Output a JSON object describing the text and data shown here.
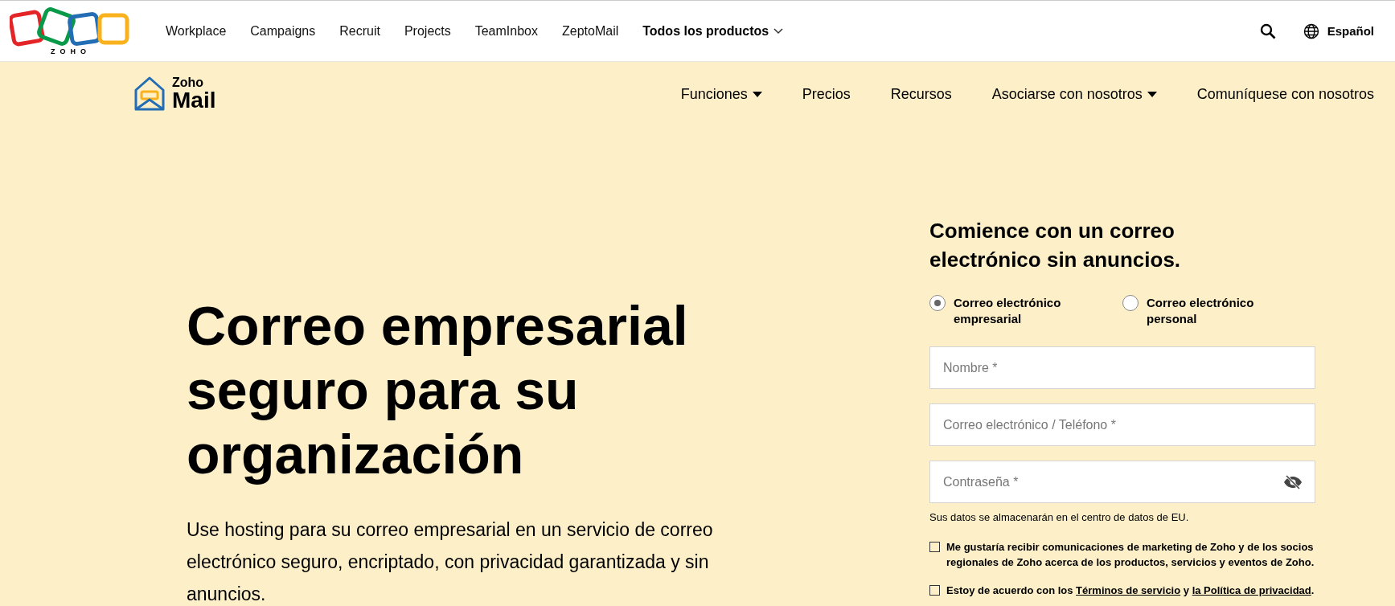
{
  "topbar": {
    "logo_text": "ZOHO",
    "products": [
      "Workplace",
      "Campaigns",
      "Recruit",
      "Projects",
      "TeamInbox",
      "ZeptoMail"
    ],
    "all_products": "Todos los productos",
    "language": "Español"
  },
  "subnav": {
    "brand_top": "Zoho",
    "brand_bottom": "Mail",
    "items": [
      {
        "label": "Funciones",
        "has_dropdown": true
      },
      {
        "label": "Precios",
        "has_dropdown": false
      },
      {
        "label": "Recursos",
        "has_dropdown": false
      },
      {
        "label": "Asociarse con nosotros",
        "has_dropdown": true
      },
      {
        "label": "Comuníquese con nosotros",
        "has_dropdown": false
      }
    ]
  },
  "hero": {
    "title": "Correo empresarial seguro para su organización",
    "description": "Use hosting para su correo empresarial en un servicio de correo electrónico seguro, encriptado, con privacidad garantizada y sin anuncios."
  },
  "signup": {
    "heading": "Comience con un correo electrónico sin anuncios.",
    "account_types": [
      {
        "label": "Correo electrónico empresarial",
        "selected": true
      },
      {
        "label": "Correo electrónico personal",
        "selected": false
      }
    ],
    "fields": [
      {
        "placeholder": "Nombre *",
        "kind": "text"
      },
      {
        "placeholder": "Correo electrónico / Teléfono *",
        "kind": "text"
      },
      {
        "placeholder": "Contraseña *",
        "kind": "password"
      }
    ],
    "data_note": "Sus datos se almacenarán en el centro de datos de EU.",
    "consents": [
      {
        "checked": false,
        "parts": [
          {
            "kind": "text",
            "text": "Me gustaría recibir comunicaciones de marketing de Zoho y de los socios regionales de Zoho acerca de los productos, servicios y eventos de Zoho."
          }
        ]
      },
      {
        "checked": false,
        "parts": [
          {
            "kind": "text",
            "text": "Estoy de acuerdo con los "
          },
          {
            "kind": "link",
            "text": "Términos de servicio"
          },
          {
            "kind": "text",
            "text": " y "
          },
          {
            "kind": "link",
            "text": "la Política de privacidad"
          },
          {
            "kind": "text",
            "text": "."
          }
        ]
      }
    ]
  }
}
